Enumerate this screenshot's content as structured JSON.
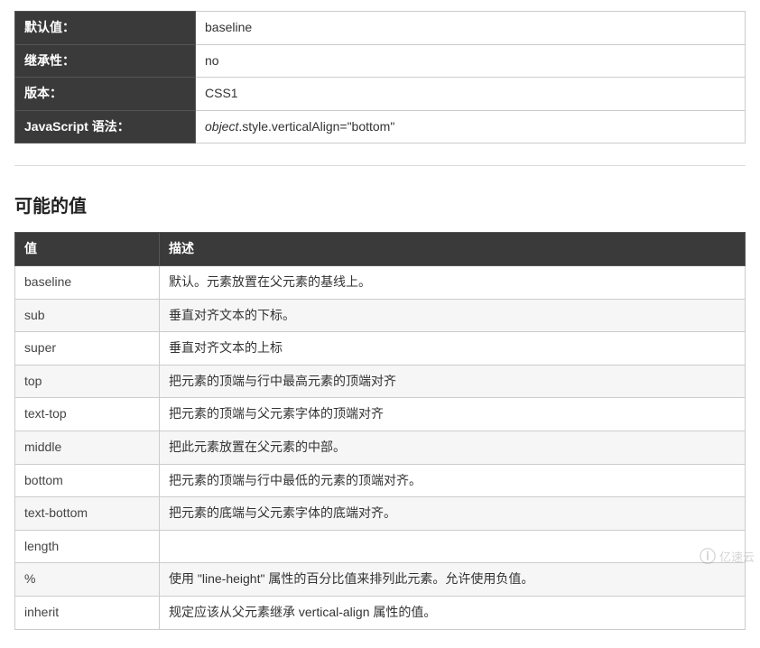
{
  "defs": {
    "rows": [
      {
        "label": "默认值：",
        "value": "baseline"
      },
      {
        "label": "继承性：",
        "value": "no"
      },
      {
        "label": "版本：",
        "value": "CSS1"
      },
      {
        "label": "JavaScript 语法：",
        "value_prefix": "object",
        "value_rest": ".style.verticalAlign=\"bottom\""
      }
    ]
  },
  "section_heading": "可能的值",
  "values_table": {
    "headers": {
      "value": "值",
      "desc": "描述"
    },
    "rows": [
      {
        "value": "baseline",
        "desc": "默认。元素放置在父元素的基线上。"
      },
      {
        "value": "sub",
        "desc": "垂直对齐文本的下标。"
      },
      {
        "value": "super",
        "desc": "垂直对齐文本的上标"
      },
      {
        "value": "top",
        "desc": "把元素的顶端与行中最高元素的顶端对齐"
      },
      {
        "value": "text-top",
        "desc": "把元素的顶端与父元素字体的顶端对齐"
      },
      {
        "value": "middle",
        "desc": "把此元素放置在父元素的中部。"
      },
      {
        "value": "bottom",
        "desc": "把元素的顶端与行中最低的元素的顶端对齐。"
      },
      {
        "value": "text-bottom",
        "desc": "把元素的底端与父元素字体的底端对齐。"
      },
      {
        "value": "length",
        "desc": ""
      },
      {
        "value": "%",
        "desc": "使用 \"line-height\" 属性的百分比值来排列此元素。允许使用负值。"
      },
      {
        "value": "inherit",
        "desc": "规定应该从父元素继承 vertical-align 属性的值。"
      }
    ]
  },
  "watermark": {
    "logo": "ⓘ",
    "text": "亿速云"
  }
}
